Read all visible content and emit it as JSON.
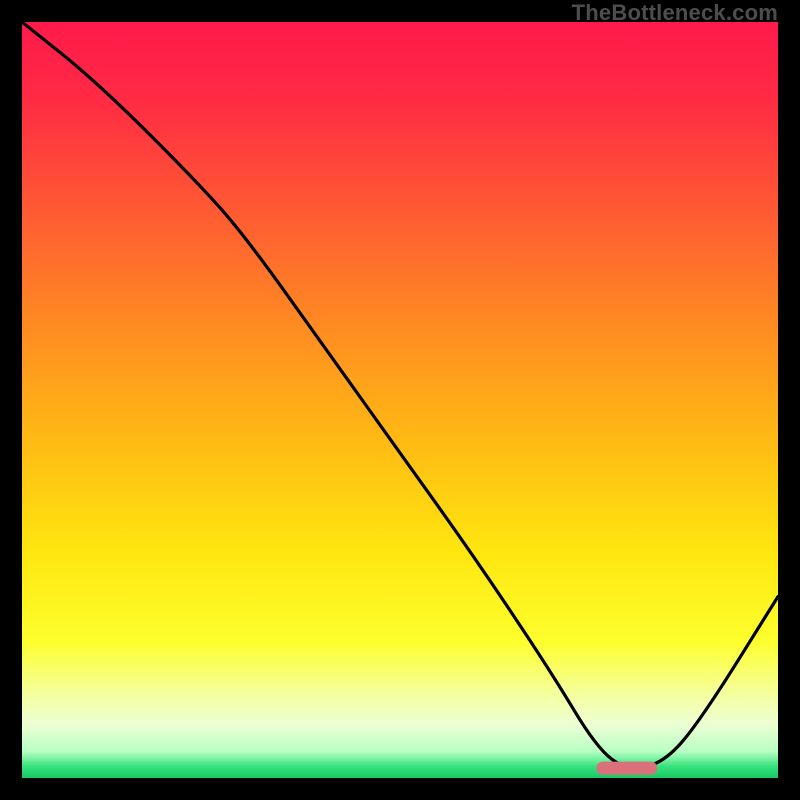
{
  "watermark": "TheBottleneck.com",
  "chart_data": {
    "type": "line",
    "title": "",
    "xlabel": "",
    "ylabel": "",
    "xlim": [
      0,
      100
    ],
    "ylim": [
      0,
      100
    ],
    "grid": false,
    "legend": false,
    "series": [
      {
        "name": "bottleneck-curve",
        "x": [
          0,
          10,
          24,
          30,
          40,
          50,
          60,
          70,
          76,
          80,
          85,
          90,
          100
        ],
        "y": [
          100,
          92,
          78,
          71,
          57,
          43,
          29,
          14,
          4,
          1,
          2,
          8,
          24
        ]
      }
    ],
    "marker": {
      "name": "optimal-range",
      "x_start": 76,
      "x_end": 84,
      "y": 1.3,
      "color": "#d9707a"
    },
    "gradient_stops": [
      {
        "offset": 0.0,
        "color": "#ff1a4b"
      },
      {
        "offset": 0.1,
        "color": "#ff2a44"
      },
      {
        "offset": 0.25,
        "color": "#ff5a33"
      },
      {
        "offset": 0.4,
        "color": "#ff8a22"
      },
      {
        "offset": 0.55,
        "color": "#ffb914"
      },
      {
        "offset": 0.7,
        "color": "#ffe60f"
      },
      {
        "offset": 0.82,
        "color": "#fdff2e"
      },
      {
        "offset": 0.89,
        "color": "#f5ffa0"
      },
      {
        "offset": 0.93,
        "color": "#ecffd4"
      },
      {
        "offset": 0.965,
        "color": "#b7ffc3"
      },
      {
        "offset": 0.985,
        "color": "#35e27c"
      },
      {
        "offset": 1.0,
        "color": "#18c765"
      }
    ]
  }
}
